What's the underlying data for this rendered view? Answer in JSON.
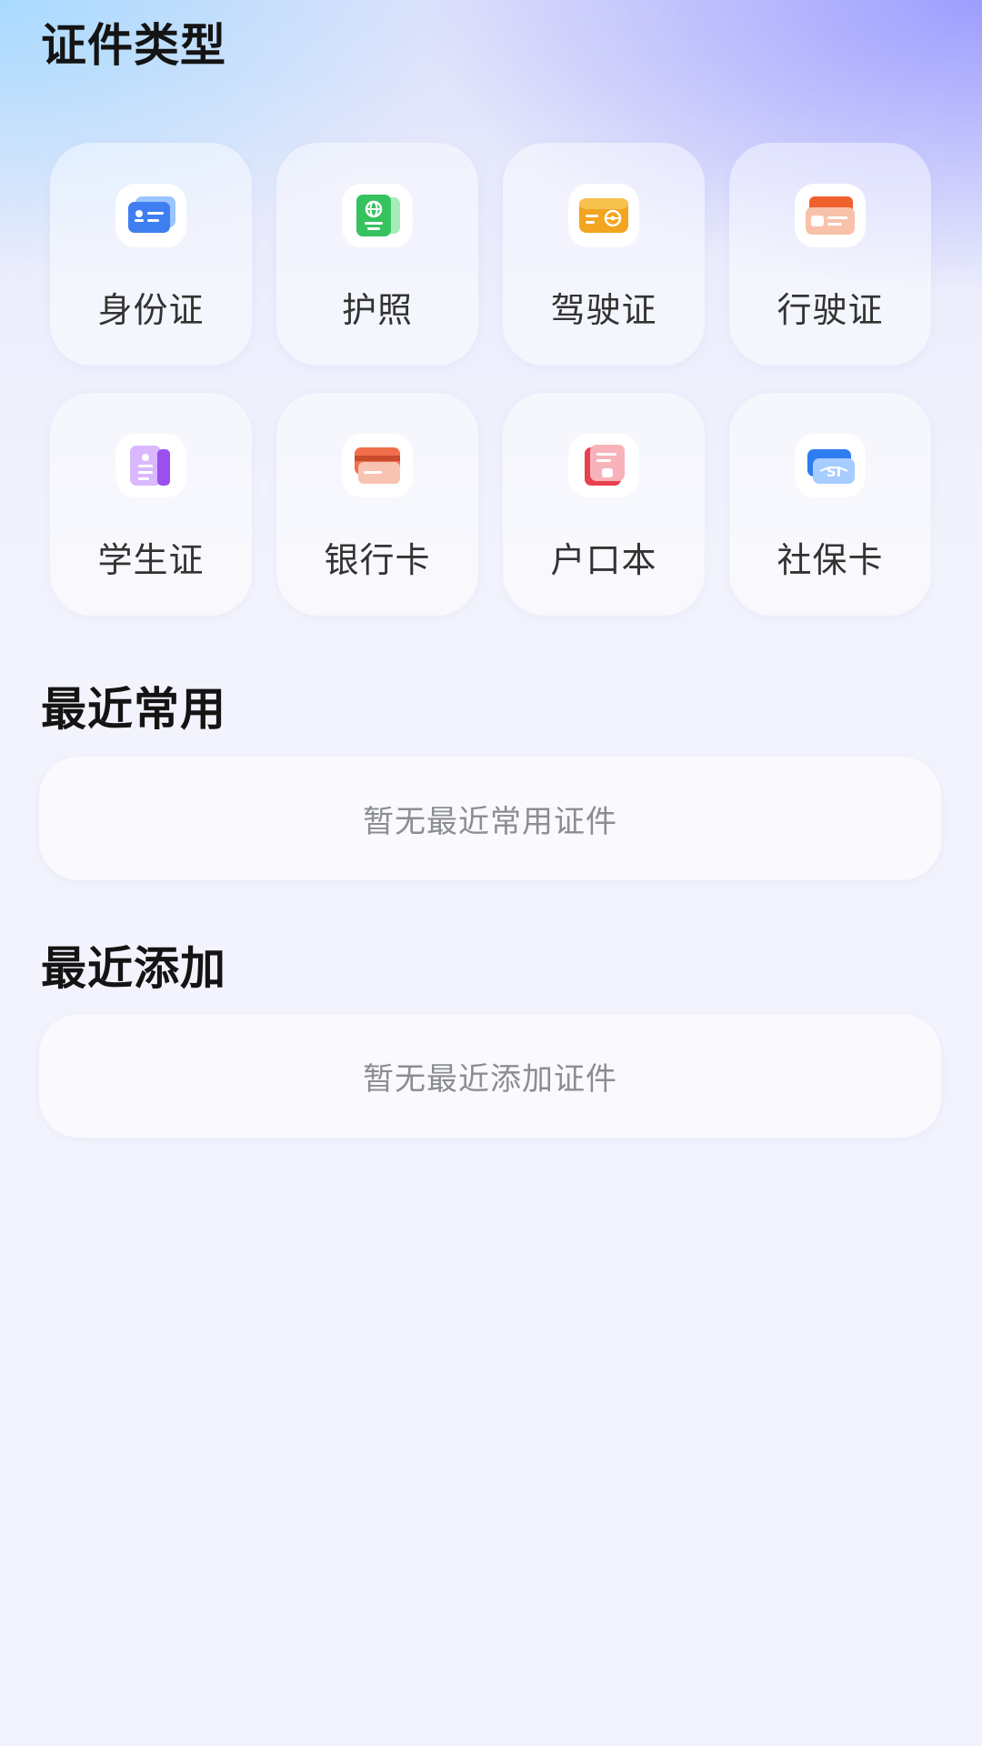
{
  "sections": {
    "types_title": "证件类型",
    "recent_used_title": "最近常用",
    "recent_added_title": "最近添加"
  },
  "types": [
    {
      "label": "身份证",
      "icon": "id-card-icon",
      "color": "#3f7ef0"
    },
    {
      "label": "护照",
      "icon": "passport-icon",
      "color": "#35c25f"
    },
    {
      "label": "驾驶证",
      "icon": "driver-license-icon",
      "color": "#f2a51e"
    },
    {
      "label": "行驶证",
      "icon": "vehicle-license-icon",
      "color": "#f0612e"
    },
    {
      "label": "学生证",
      "icon": "student-card-icon",
      "color": "#9b4ff0"
    },
    {
      "label": "银行卡",
      "icon": "bank-card-icon",
      "color": "#f06f4a"
    },
    {
      "label": "户口本",
      "icon": "household-register-icon",
      "color": "#e8414f"
    },
    {
      "label": "社保卡",
      "icon": "social-security-card-icon",
      "color": "#2e7df0"
    }
  ],
  "recent_used": {
    "empty_text": "暂无最近常用证件"
  },
  "recent_added": {
    "empty_text": "暂无最近添加证件"
  }
}
